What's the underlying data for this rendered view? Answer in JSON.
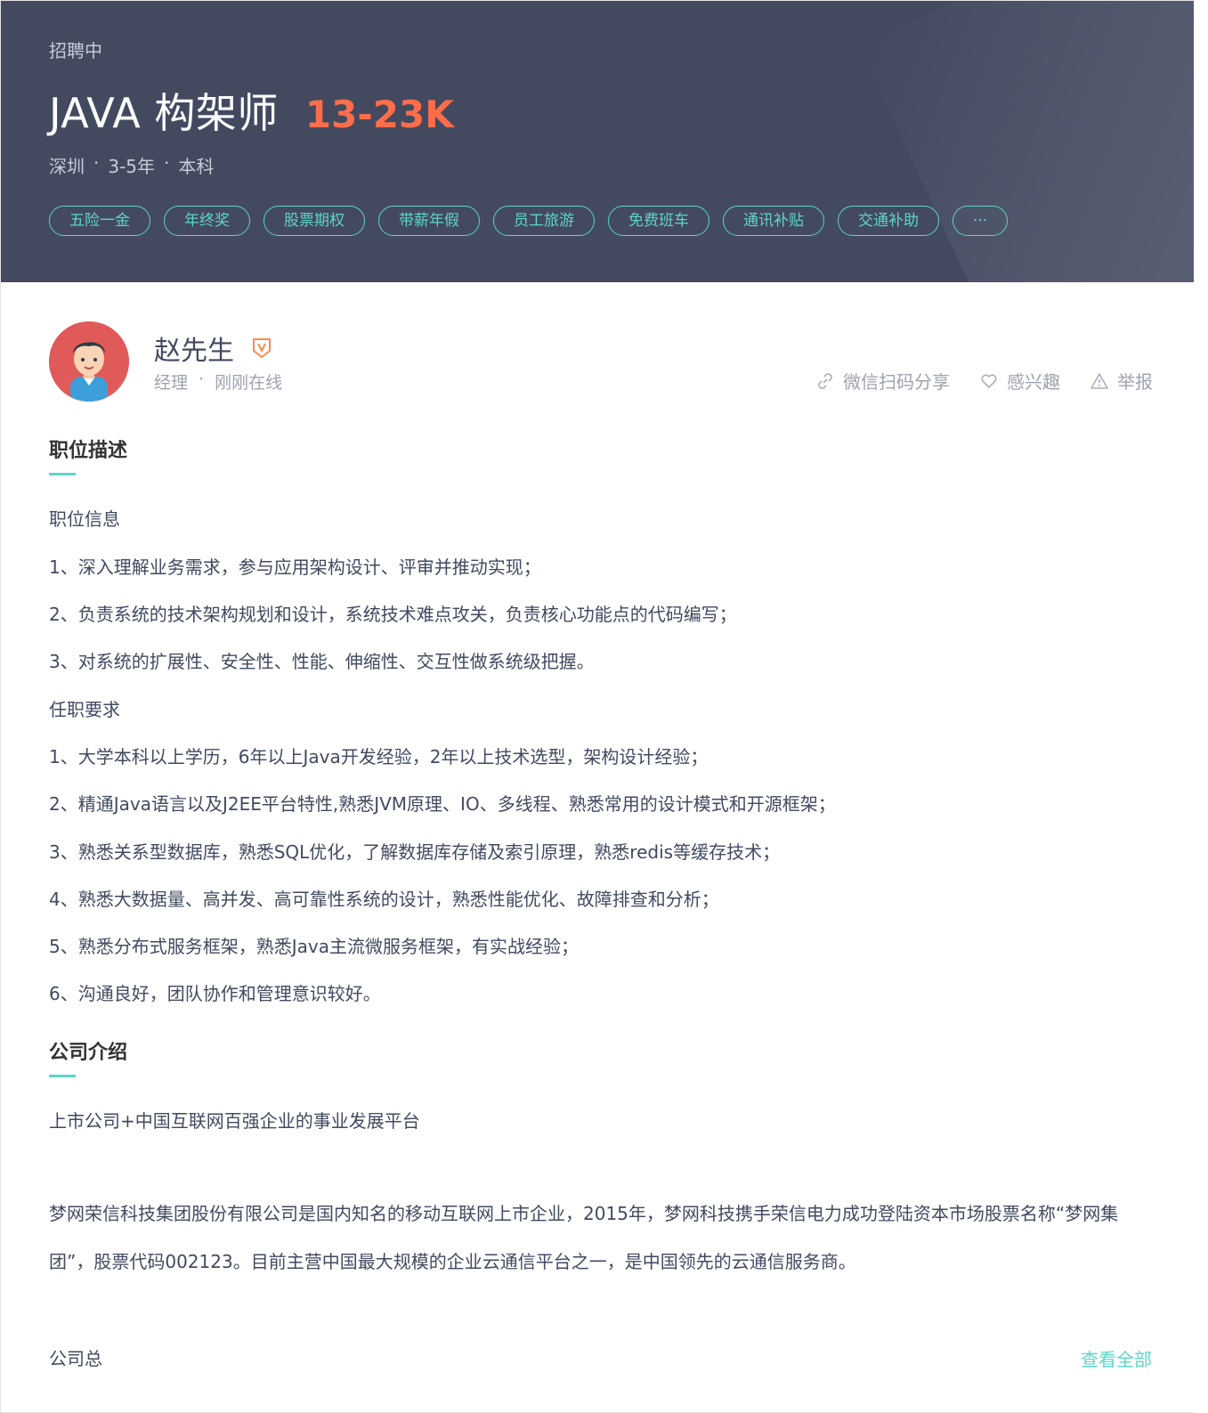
{
  "header": {
    "status": "招聘中",
    "job_title": "JAVA 构架师",
    "salary": "13-23K",
    "meta": {
      "city": "深圳",
      "experience": "3-5年",
      "education": "本科",
      "separator": "·"
    },
    "tags": [
      "五险一金",
      "年终奖",
      "股票期权",
      "带薪年假",
      "员工旅游",
      "免费班车",
      "通讯补贴",
      "交通补助",
      "···"
    ]
  },
  "recruiter": {
    "name": "赵先生",
    "title": "经理",
    "separator": "·",
    "online_status": "刚刚在线"
  },
  "actions": {
    "share": "微信扫码分享",
    "interest": "感兴趣",
    "report": "举报"
  },
  "job_description": {
    "title": "职位描述",
    "info_heading": "职位信息",
    "info_items": [
      "1、深入理解业务需求，参与应用架构设计、评审并推动实现；",
      "2、负责系统的技术架构规划和设计，系统技术难点攻关，负责核心功能点的代码编写；",
      "3、对系统的扩展性、安全性、性能、伸缩性、交互性做系统级把握。"
    ],
    "req_heading": "任职要求",
    "req_items": [
      "1、大学本科以上学历，6年以上Java开发经验，2年以上技术选型，架构设计经验；",
      "2、精通Java语言以及J2EE平台特性,熟悉JVM原理、IO、多线程、熟悉常用的设计模式和开源框架；",
      "3、熟悉关系型数据库，熟悉SQL优化，了解数据库存储及索引原理，熟悉redis等缓存技术；",
      "4、熟悉大数据量、高并发、高可靠性系统的设计，熟悉性能优化、故障排查和分析；",
      "5、熟悉分布式服务框架，熟悉Java主流微服务框架，有实战经验；",
      "6、沟通良好，团队协作和管理意识较好。"
    ]
  },
  "company": {
    "title": "公司介绍",
    "tagline": "上市公司+中国互联网百强企业的事业发展平台",
    "description": "梦网荣信科技集团股份有限公司是国内知名的移动互联网上市企业，2015年，梦网科技携手荣信电力成功登陆资本市场股票名称“梦网集团”，股票代码002123。目前主营中国最大规模的企业云通信平台之一，是中国领先的云通信服务商。",
    "footer_text": "公司总",
    "view_all": "查看全部"
  },
  "colors": {
    "banner_bg": "#434a60",
    "salary": "#fe6d4a",
    "accent": "#5dd5c8"
  }
}
